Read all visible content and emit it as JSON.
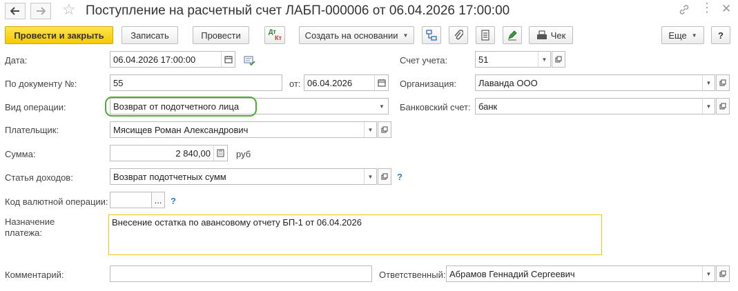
{
  "window": {
    "title": "Поступление на расчетный счет ЛАБП-000006 от 06.04.2026 17:00:00"
  },
  "toolbar": {
    "post_close": "Провести и закрыть",
    "save": "Записать",
    "post": "Провести",
    "dt_kt_top": "Дт",
    "dt_kt_bottom": "Кт",
    "create_based": "Создать на основании",
    "check": "Чек",
    "more": "Еще",
    "help": "?"
  },
  "form": {
    "date": {
      "label": "Дата:",
      "value": "06.04.2026 17:00:00"
    },
    "doc_number": {
      "label": "По документу №:",
      "value": "55"
    },
    "doc_date": {
      "label": "от:",
      "value": "06.04.2026"
    },
    "operation_type": {
      "label": "Вид операции:",
      "value": "Возврат от подотчетного лица"
    },
    "payer": {
      "label": "Плательщик:",
      "value": "Мясищев Роман Александрович"
    },
    "amount": {
      "label": "Сумма:",
      "value": "2 840,00",
      "currency": "руб"
    },
    "income_item": {
      "label": "Статья доходов:",
      "value": "Возврат подотчетных сумм",
      "help": "?"
    },
    "currency_op_code": {
      "label": "Код валютной операции:",
      "value": "",
      "picker": "...",
      "help": "?"
    },
    "purpose": {
      "label_line1": "Назначение",
      "label_line2": "платежа:",
      "value": "Внесение остатка по авансовому отчету БП-1 от 06.04.2026"
    },
    "comment": {
      "label": "Комментарий:",
      "value": ""
    },
    "responsible": {
      "label": "Ответственный:",
      "value": "Абрамов Геннадий Сергеевич"
    },
    "account": {
      "label": "Счет учета:",
      "value": "51"
    },
    "organization": {
      "label": "Организация:",
      "value": "Лаванда ООО"
    },
    "bank_account": {
      "label": "Банковский счет:",
      "value": "банк"
    }
  },
  "colors": {
    "primary_button": "#f5c800",
    "highlight_green": "#4cae30",
    "highlight_yellow": "#f1c40f",
    "help_blue": "#2a7fc7"
  }
}
